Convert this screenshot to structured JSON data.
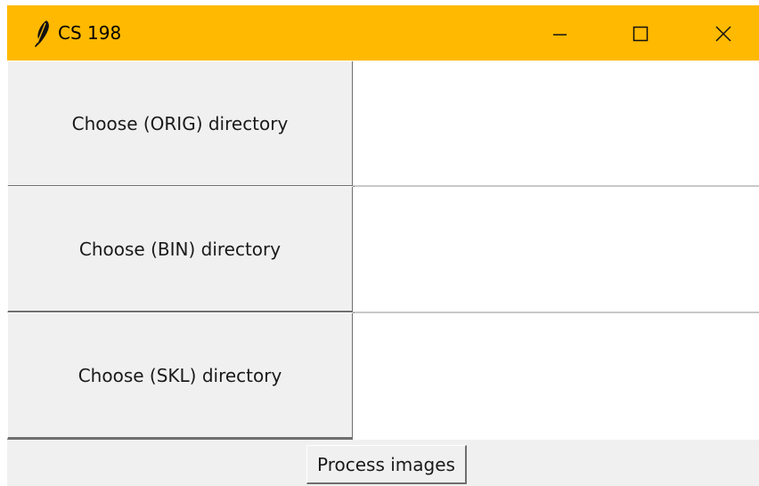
{
  "window": {
    "title": "CS 198",
    "app_icon": "feather-icon",
    "titlebar_color": "#ffb900",
    "controls": {
      "minimize_icon": "minimize-icon",
      "maximize_icon": "maximize-icon",
      "close_icon": "close-icon"
    }
  },
  "rows": [
    {
      "button_label": "Choose (ORIG) directory",
      "entry_value": ""
    },
    {
      "button_label": "Choose (BIN) directory",
      "entry_value": ""
    },
    {
      "button_label": "Choose (SKL) directory",
      "entry_value": ""
    }
  ],
  "footer": {
    "process_label": "Process images"
  }
}
